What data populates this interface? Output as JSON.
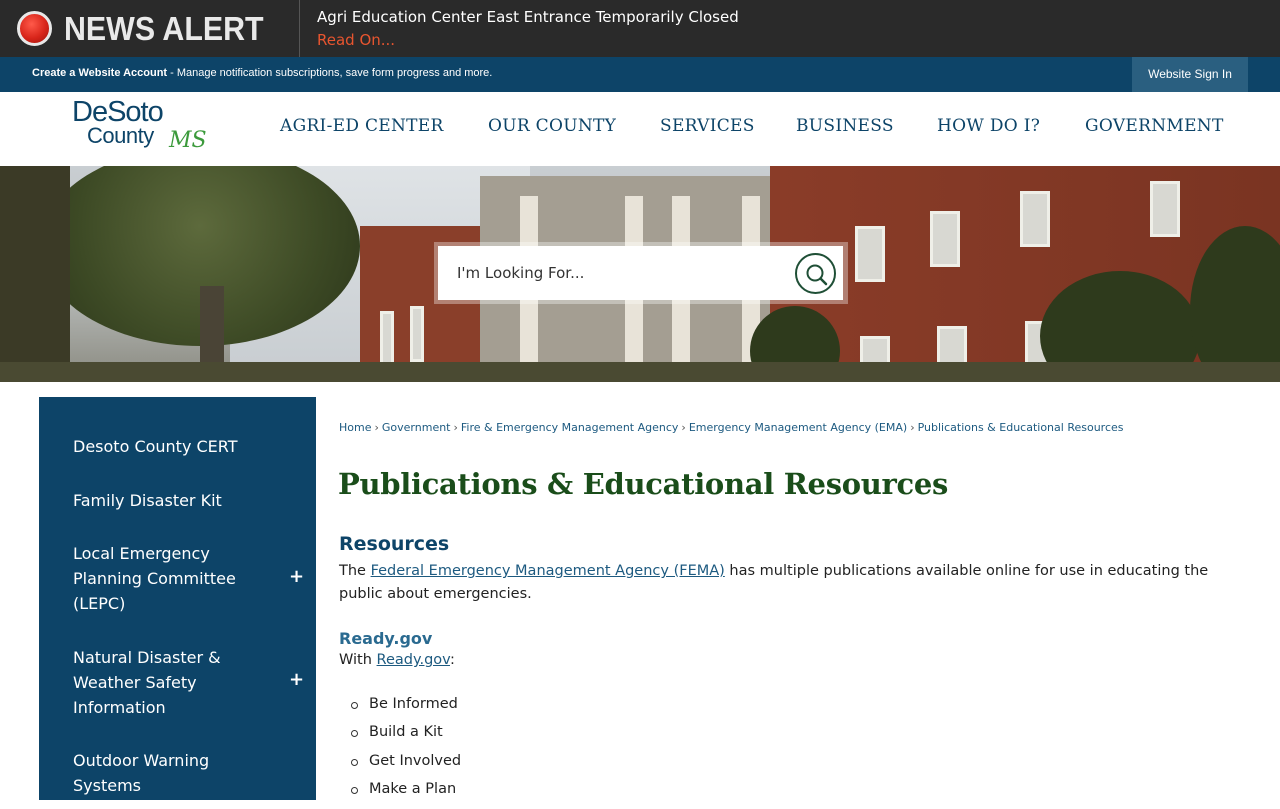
{
  "alert": {
    "title": "NEWS ALERT",
    "headline": "Agri Education Center East Entrance Temporarily Closed",
    "link": "Read On..."
  },
  "account": {
    "create_label": "Create a Website Account",
    "description": " - Manage notification subscriptions, save form progress and more.",
    "signin_label": "Website Sign In"
  },
  "logo": {
    "line1": "DeSoto",
    "line2": "County",
    "mark": "MS"
  },
  "nav": {
    "items": [
      "AGRI-ED CENTER",
      "OUR COUNTY",
      "SERVICES",
      "BUSINESS",
      "HOW DO I?",
      "GOVERNMENT"
    ]
  },
  "search": {
    "placeholder": "I'm Looking For...",
    "icon": "search-icon"
  },
  "sidebar": {
    "items": [
      {
        "label": "Desoto County CERT",
        "expandable": false
      },
      {
        "label": "Family Disaster Kit",
        "expandable": false
      },
      {
        "label": "Local Emergency Planning Committee (LEPC)",
        "expandable": true
      },
      {
        "label": "Natural Disaster & Weather Safety Information",
        "expandable": true
      },
      {
        "label": "Outdoor Warning Systems",
        "expandable": false
      }
    ],
    "expand_symbol": "+"
  },
  "breadcrumb": {
    "items": [
      "Home",
      "Government",
      "Fire & Emergency Management Agency",
      "Emergency Management Agency (EMA)",
      "Publications & Educational Resources"
    ],
    "separator": "›"
  },
  "content": {
    "title": "Publications & Educational Resources",
    "resources_heading": "Resources",
    "para_prefix": "The ",
    "fema_link": "Federal Emergency Management Agency (FEMA)",
    "para_suffix": " has multiple publications available online for use in educating the public about emergencies.",
    "ready_heading": "Ready.gov",
    "with_prefix": "With ",
    "ready_link": "Ready.gov",
    "with_suffix": ":",
    "list": [
      "Be Informed",
      "Build a Kit",
      "Get Involved",
      "Make a Plan"
    ]
  }
}
